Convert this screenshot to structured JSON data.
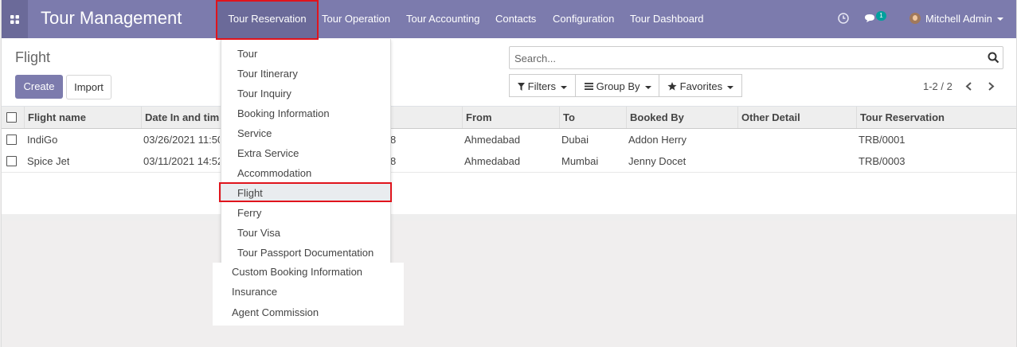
{
  "app": {
    "title": "Tour Management"
  },
  "nav": {
    "items": [
      {
        "label": "Tour Reservation"
      },
      {
        "label": "Tour Operation"
      },
      {
        "label": "Tour Accounting"
      },
      {
        "label": "Contacts"
      },
      {
        "label": "Configuration"
      },
      {
        "label": "Tour Dashboard"
      }
    ],
    "messages_count": "1",
    "user": "Mitchell Admin"
  },
  "page": {
    "title": "Flight",
    "create_label": "Create",
    "import_label": "Import",
    "search_placeholder": "Search...",
    "filters_label": "Filters",
    "groupby_label": "Group By",
    "favorites_label": "Favorites",
    "pager": "1-2 / 2"
  },
  "table": {
    "columns": [
      "Flight name",
      "Date In and tim",
      "From",
      "To",
      "Booked By",
      "Other Detail",
      "Tour Reservation"
    ],
    "rows": [
      {
        "name": "IndiGo",
        "date": "03/26/2021 11:50",
        "hidden_tail": "8",
        "from": "Ahmedabad",
        "to": "Dubai",
        "booked_by": "Addon Herry",
        "other": "",
        "reservation": "TRB/0001"
      },
      {
        "name": "Spice Jet",
        "date": "03/11/2021 14:52",
        "hidden_tail": "8",
        "from": "Ahmedabad",
        "to": "Mumbai",
        "booked_by": "Jenny Docet",
        "other": "",
        "reservation": "TRB/0003"
      }
    ]
  },
  "dropdown": {
    "items": [
      "Tour",
      "Tour Itinerary",
      "Tour Inquiry",
      "Booking Information",
      "Service",
      "Extra Service",
      "Accommodation",
      "Flight",
      "Ferry",
      "Tour Visa",
      "Tour Passport Documentation"
    ],
    "highlighted": "Flight",
    "extra_items": [
      "Custom Booking Information",
      "Insurance",
      "Agent Commission"
    ]
  },
  "colors": {
    "navbar": "#7c7bad",
    "navbar_dark": "#6b6a99",
    "badge": "#00a09d",
    "highlight_box": "#e0141c"
  }
}
